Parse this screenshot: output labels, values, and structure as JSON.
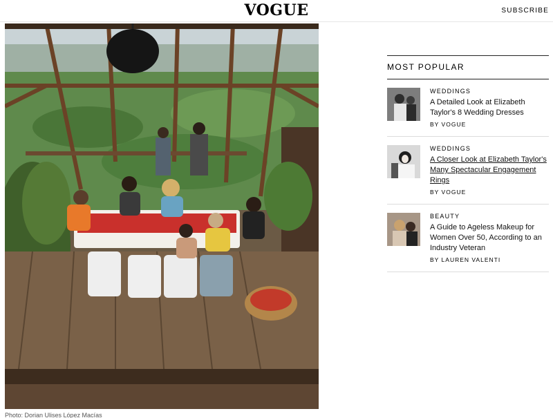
{
  "header": {
    "logo": "VOGUE",
    "subscribe_label": "SUBSCRIBE"
  },
  "photo": {
    "caption": "Photo: Dorian Ulises López Macías"
  },
  "most_popular": {
    "heading": "MOST POPULAR",
    "items": [
      {
        "category": "WEDDINGS",
        "title": "A Detailed Look at Elizabeth Taylor's 8 Wedding Dresses",
        "byline": "BY VOGUE"
      },
      {
        "category": "WEDDINGS",
        "title": "A Closer Look at Elizabeth Taylor's Many Spectacular Engagement Rings",
        "byline": "BY VOGUE"
      },
      {
        "category": "BEAUTY",
        "title": "A Guide to Ageless Makeup for Women Over 50, According to an Industry Veteran",
        "byline": "BY LAUREN VALENTI"
      }
    ]
  }
}
